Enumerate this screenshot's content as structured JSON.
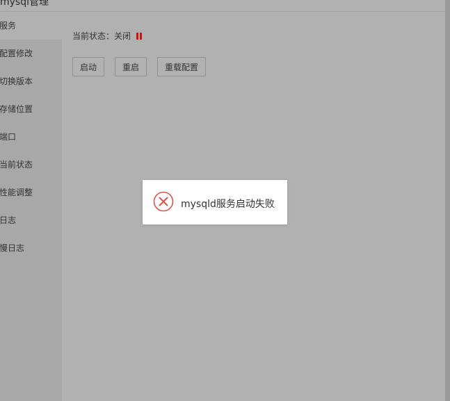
{
  "window": {
    "title": "mysql管理"
  },
  "sidebar": {
    "items": [
      {
        "label": "服务",
        "active": true
      },
      {
        "label": "配置修改",
        "active": false
      },
      {
        "label": "切换版本",
        "active": false
      },
      {
        "label": "存储位置",
        "active": false
      },
      {
        "label": "端口",
        "active": false
      },
      {
        "label": "当前状态",
        "active": false
      },
      {
        "label": "性能调整",
        "active": false
      },
      {
        "label": "日志",
        "active": false
      },
      {
        "label": "慢日志",
        "active": false
      }
    ]
  },
  "service": {
    "status_label": "当前状态：",
    "status_value": "关闭",
    "status_icon": "pause-icon",
    "status_color": "#cc1111",
    "buttons": {
      "start": "启动",
      "restart": "重启",
      "reload": "重载配置"
    }
  },
  "toast": {
    "icon": "error-circle-icon",
    "icon_color": "#e0524b",
    "message": "mysqld服务启动失败"
  }
}
